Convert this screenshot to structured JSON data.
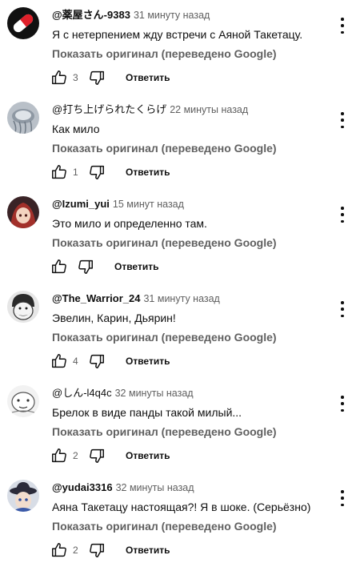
{
  "comments": [
    {
      "author": "@薬屋さん-9383",
      "time": "31 минуту назад",
      "text": "Я с нетерпением жду встречи с Аяной Такетацу.",
      "translate": "Показать оригинал (переведено Google)",
      "likes": "3",
      "reply": "Ответить",
      "avatar_icon": "pill-capsule-icon"
    },
    {
      "author": "@打ち上げられたくらげ",
      "time": "22 минуты назад",
      "text": "Как мило",
      "translate": "Показать оригинал (переведено Google)",
      "likes": "1",
      "reply": "Ответить",
      "avatar_icon": "jellyfish-icon"
    },
    {
      "author": "@Izumi_yui",
      "time": "15 минут назад",
      "text": "Это мило и определенно там.",
      "translate": "Показать оригинал (переведено Google)",
      "likes": "",
      "reply": "Ответить",
      "avatar_icon": "anime-girl-icon"
    },
    {
      "author": "@The_Warrior_24",
      "time": "31 минуту назад",
      "text": "Эвелин, Карин, Дьярин!",
      "translate": "Показать оригинал (переведено Google)",
      "likes": "4",
      "reply": "Ответить",
      "avatar_icon": "cartoon-face-icon"
    },
    {
      "author": "@しん-l4q4c",
      "time": "32 минуты назад",
      "text": "Брелок в виде панды такой милый...",
      "translate": "Показать оригинал (переведено Google)",
      "likes": "2",
      "reply": "Ответить",
      "avatar_icon": "sketch-face-icon"
    },
    {
      "author": "@yudai3316",
      "time": "32 минуты назад",
      "text": "Аяна Такетацу настоящая?! Я в шоке. (Серьёзно)",
      "translate": "Показать оригинал (переведено Google)",
      "likes": "2",
      "reply": "Ответить",
      "avatar_icon": "hat-character-icon"
    }
  ],
  "colors": {
    "text_primary": "#0f0f0f",
    "text_secondary": "#606060",
    "background": "#ffffff"
  }
}
